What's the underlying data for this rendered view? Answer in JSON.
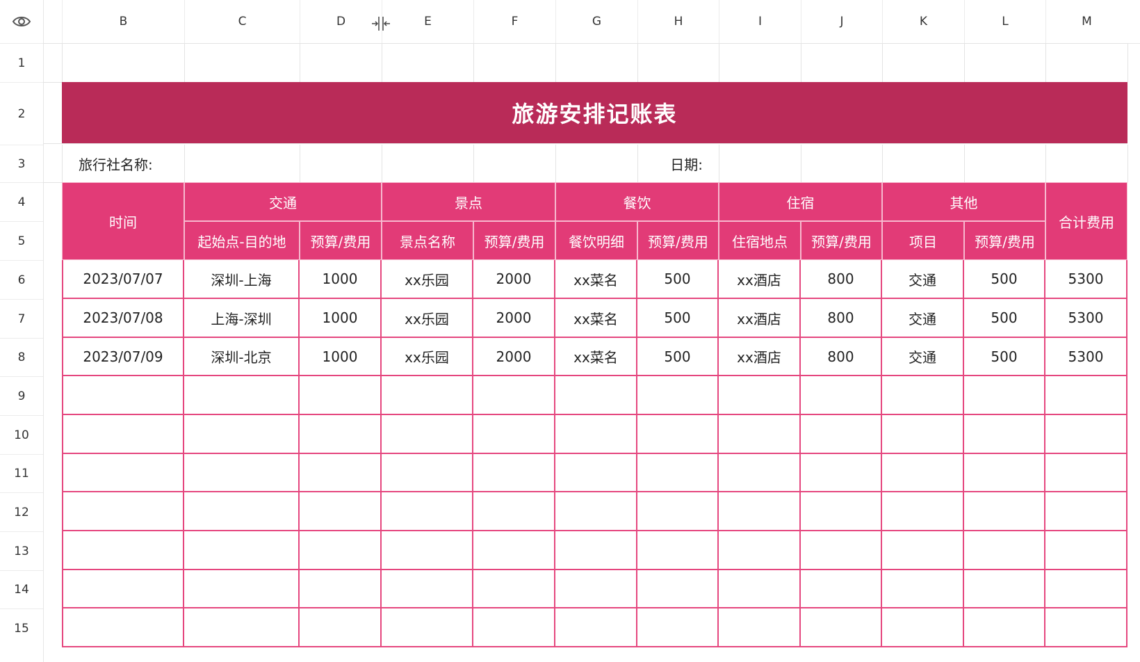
{
  "columns": [
    "B",
    "C",
    "D",
    "E",
    "F",
    "G",
    "H",
    "I",
    "J",
    "K",
    "L",
    "M"
  ],
  "rows": [
    "1",
    "2",
    "3",
    "4",
    "5",
    "6",
    "7",
    "8",
    "9",
    "10",
    "11",
    "12",
    "13",
    "14",
    "15"
  ],
  "title": "旅游安排记账表",
  "agency_label": "旅行社名称:",
  "date_label": "日期:",
  "headers": {
    "time": "时间",
    "transport": "交通",
    "sights": "景点",
    "dining": "餐饮",
    "lodging": "住宿",
    "other": "其他",
    "total": "合计费用",
    "route": "起始点-目的地",
    "budget": "预算/费用",
    "sight_name": "景点名称",
    "dining_detail": "餐饮明细",
    "lodging_place": "住宿地点",
    "item": "项目"
  },
  "records": [
    [
      "2023/07/07",
      "深圳-上海",
      "1000",
      "xx乐园",
      "2000",
      "xx菜名",
      "500",
      "xx酒店",
      "800",
      "交通",
      "500",
      "5300"
    ],
    [
      "2023/07/08",
      "上海-深圳",
      "1000",
      "xx乐园",
      "2000",
      "xx菜名",
      "500",
      "xx酒店",
      "800",
      "交通",
      "500",
      "5300"
    ],
    [
      "2023/07/09",
      "深圳-北京",
      "1000",
      "xx乐园",
      "2000",
      "xx菜名",
      "500",
      "xx酒店",
      "800",
      "交通",
      "500",
      "5300"
    ]
  ],
  "colors": {
    "title_band": "#b92b58",
    "header_fill": "#e23b77",
    "table_border": "#e5467e"
  },
  "icons": {
    "corner": "eye-icon",
    "column_resize": "column-resize-icon"
  }
}
